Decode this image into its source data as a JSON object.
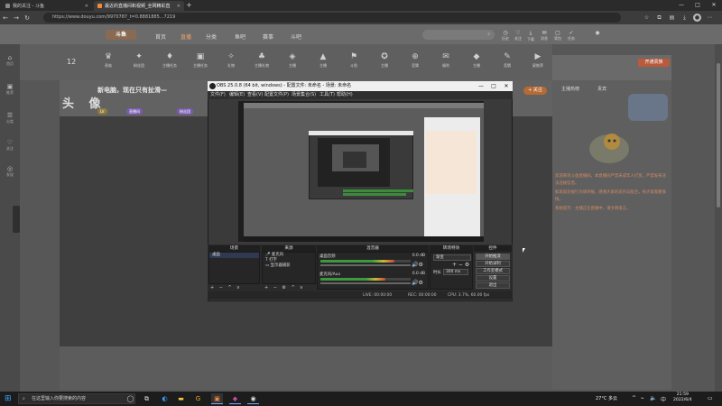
{
  "browser": {
    "tabs": [
      {
        "title": "我的关注 - 斗鱼",
        "active": false
      },
      {
        "title": "最近的直播间和视频_全网精彩直",
        "active": true
      }
    ],
    "new_tab": "+",
    "url": "https://www.douyu.com/9970787_t=0.8881885...7219",
    "window_controls": [
      "—",
      "□",
      "✕"
    ]
  },
  "site": {
    "logo": "斗鱼",
    "nav": [
      "首页",
      "直播",
      "分类",
      "鱼吧",
      "赛事",
      "斗吧"
    ],
    "active_nav": 1,
    "search_placeholder": "",
    "header_icons": [
      {
        "icon": "history-icon",
        "label": "历史"
      },
      {
        "icon": "follow-icon",
        "label": "关注"
      },
      {
        "icon": "download-icon",
        "label": "下载"
      },
      {
        "icon": "message-icon",
        "label": "消息"
      },
      {
        "icon": "bag-icon",
        "label": "背包"
      },
      {
        "icon": "task-icon",
        "label": "任务"
      }
    ],
    "user_level": "12",
    "rail": [
      {
        "icon": "⌂",
        "label": "首页"
      },
      {
        "icon": "▣",
        "label": "推荐"
      },
      {
        "icon": "☰",
        "label": "分类"
      },
      {
        "icon": "♡",
        "label": "关注"
      },
      {
        "icon": "◎",
        "label": "发现"
      }
    ],
    "categories": [
      "贵族",
      "粉丝团",
      "主播任务",
      "主播任务",
      "礼物",
      "主播礼物",
      "主播",
      "主播",
      "斗鱼",
      "主播",
      "竞猜",
      "福利",
      "主播",
      "竞猜",
      "星推荐"
    ],
    "room_title": "新电脑，现在只有扯滑—",
    "room_avatar_text": "头 像",
    "room_tags": [
      "LV",
      "直播间",
      "粉丝团"
    ],
    "follow_label": "+ 关注",
    "right_button": "开通贵族",
    "right_tabs": [
      "主播热榜",
      "贵宾"
    ],
    "chat": [
      "欢迎来到斗鱼直播间，本直播间严禁未成年人打赏，严禁发布违法违规信息。",
      "如发现违规行为请举报，感谢大家的支持与配合，祝大家观看愉快。",
      "系统提示：主播正在直播中，请文明发言。"
    ]
  },
  "obs": {
    "title": "OBS 25.0.8 (64 bit, windows) - 配置文件: 未命名 - 场景: 未命名",
    "menu": [
      "文件(F)",
      "编辑(E)",
      "查看(V)",
      "配置文件(P)",
      "场景集合(S)",
      "工具(T)",
      "帮助(H)"
    ],
    "docks": [
      "场景",
      "来源",
      "混音器",
      "转场特效",
      "控件"
    ],
    "scenes": [
      "桌面"
    ],
    "sources": [
      "麦克风",
      "打字",
      "显示器捕获"
    ],
    "mixer": [
      {
        "name": "桌面音频",
        "db": "0.0 dB",
        "level": 0.82
      },
      {
        "name": "麦克风/Aux",
        "db": "0.0 dB",
        "level": 0.72
      }
    ],
    "transition_label": "渐变",
    "duration_label": "时长",
    "duration_value": "300 ms",
    "controls": [
      "开始推流",
      "开始录制",
      "工作室模式",
      "设置",
      "退出"
    ],
    "status": {
      "live": "LIVE: 00:00:00",
      "rec": "REC: 00:00:00",
      "cpu": "CPU: 3.7%, 60.00 fps"
    }
  },
  "taskbar": {
    "search_placeholder": "在这里输入你要搜索的内容",
    "weather": "27°C 多云",
    "time": "21:59",
    "date": "2022/6/4"
  }
}
